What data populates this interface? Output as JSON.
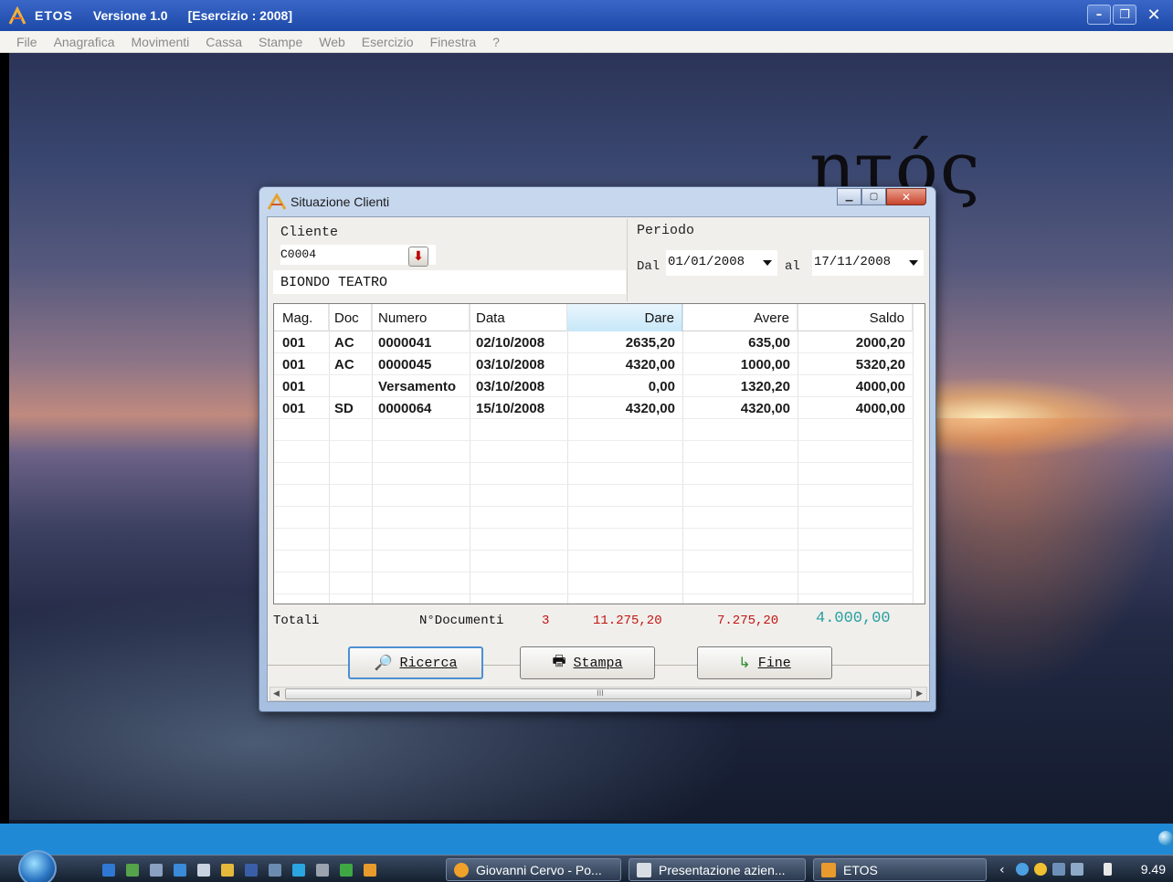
{
  "app": {
    "title": "ETOS",
    "version": "Versione 1.0",
    "esercizio": "[Esercizio : 2008]"
  },
  "menu": [
    "File",
    "Anagrafica",
    "Movimenti",
    "Cassa",
    "Stampe",
    "Web",
    "Esercizio",
    "Finestra",
    "?"
  ],
  "wallpaper_logo": "ητός",
  "dialog": {
    "title": "Situazione Clienti",
    "cliente": {
      "label": "Cliente",
      "code": "C0004",
      "name": "BIONDO TEATRO"
    },
    "periodo": {
      "label": "Periodo",
      "dal_label": "Dal",
      "dal_value": "01/01/2008",
      "al_label": "al",
      "al_value": "17/11/2008"
    },
    "columns": [
      "Mag.",
      "Doc",
      "Numero",
      "Data",
      "Dare",
      "Avere",
      "Saldo"
    ],
    "rows": [
      [
        "001",
        "AC",
        "0000041",
        "02/10/2008",
        "2635,20",
        "635,00",
        "2000,20"
      ],
      [
        "001",
        "AC",
        "0000045",
        "03/10/2008",
        "4320,00",
        "1000,00",
        "5320,20"
      ],
      [
        "001",
        "",
        "Versamento",
        "03/10/2008",
        "0,00",
        "1320,20",
        "4000,00"
      ],
      [
        "001",
        "SD",
        "0000064",
        "15/10/2008",
        "4320,00",
        "4320,00",
        "4000,00"
      ]
    ],
    "totals": {
      "label": "Totali",
      "ndoc_label": "N°Documenti",
      "ndoc_value": "3",
      "dare": "11.275,20",
      "avere": "7.275,20",
      "saldo": "4.000,00"
    },
    "buttons": {
      "ricerca": "Ricerca",
      "stampa": "Stampa",
      "fine": "Fine"
    },
    "scrollbar_grip": "III"
  },
  "taskbar": {
    "tasks": [
      "Giovanni Cervo - Po...",
      "Presentazione azien...",
      "ETOS"
    ],
    "clock": "9.49"
  },
  "colors": {
    "titlebar": "#1d4aa8",
    "totals_red": "#c01414",
    "saldo_teal": "#2aa0a0",
    "band_blue": "#1f89d6"
  }
}
